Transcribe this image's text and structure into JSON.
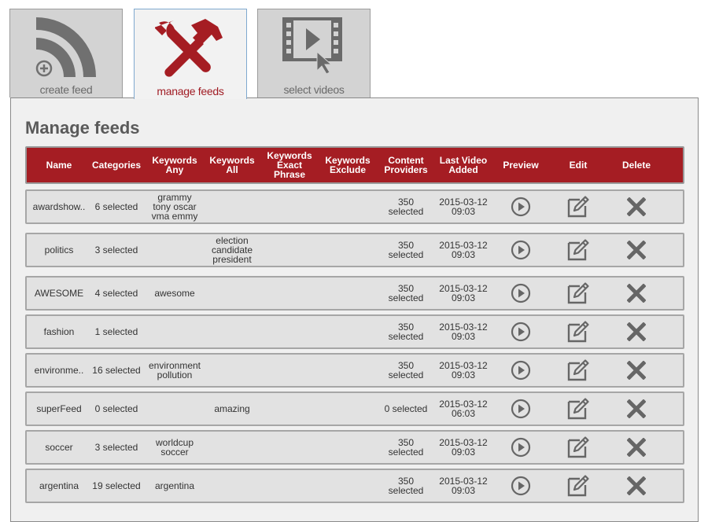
{
  "tabs": [
    {
      "label": "create feed",
      "icon": "rss-plus-icon"
    },
    {
      "label": "manage feeds",
      "icon": "tools-icon",
      "active": true
    },
    {
      "label": "select videos",
      "icon": "film-cursor-icon"
    }
  ],
  "page_title": "Manage feeds",
  "columns": [
    "Name",
    "Categories",
    "Keywords\nAny",
    "Keywords\nAll",
    "Keywords\nExact\nPhrase",
    "Keywords\nExclude",
    "Content\nProviders",
    "Last Video\nAdded",
    "Preview",
    "Edit",
    "Delete"
  ],
  "rows": [
    {
      "name": "awardshow..",
      "categories": "6 selected",
      "kw_any": "grammy\ntony oscar\nvma emmy",
      "kw_all": "",
      "kw_exact": "",
      "kw_exclude": "",
      "providers": "350\nselected",
      "last_added": "2015-03-12\n09:03"
    },
    {
      "name": "politics",
      "categories": "3 selected",
      "kw_any": "",
      "kw_all": "election\ncandidate\npresident",
      "kw_exact": "",
      "kw_exclude": "",
      "providers": "350\nselected",
      "last_added": "2015-03-12\n09:03"
    },
    {
      "name": "AWESOME",
      "categories": "4 selected",
      "kw_any": "awesome",
      "kw_all": "",
      "kw_exact": "",
      "kw_exclude": "",
      "providers": "350\nselected",
      "last_added": "2015-03-12\n09:03"
    },
    {
      "name": "fashion",
      "categories": "1 selected",
      "kw_any": "",
      "kw_all": "",
      "kw_exact": "",
      "kw_exclude": "",
      "providers": "350\nselected",
      "last_added": "2015-03-12\n09:03"
    },
    {
      "name": "environme..",
      "categories": "16 selected",
      "kw_any": "environment\npollution",
      "kw_all": "",
      "kw_exact": "",
      "kw_exclude": "",
      "providers": "350\nselected",
      "last_added": "2015-03-12\n09:03"
    },
    {
      "name": "superFeed",
      "categories": "0 selected",
      "kw_any": "",
      "kw_all": "amazing",
      "kw_exact": "",
      "kw_exclude": "",
      "providers": "0 selected",
      "last_added": "2015-03-12\n06:03"
    },
    {
      "name": "soccer",
      "categories": "3 selected",
      "kw_any": "worldcup\nsoccer",
      "kw_all": "",
      "kw_exact": "",
      "kw_exclude": "",
      "providers": "350\nselected",
      "last_added": "2015-03-12\n09:03"
    },
    {
      "name": "argentina",
      "categories": "19 selected",
      "kw_any": "argentina",
      "kw_all": "",
      "kw_exact": "",
      "kw_exclude": "",
      "providers": "350\nselected",
      "last_added": "2015-03-12\n09:03"
    }
  ],
  "row_action_icons": {
    "preview": "play-circle-icon",
    "edit": "edit-icon",
    "delete": "delete-x-icon"
  },
  "colors": {
    "accent": "#a51d23",
    "icon_gray": "#666666",
    "tab_bg": "#d3d3d3",
    "panel_bg": "#f0f0f0"
  }
}
